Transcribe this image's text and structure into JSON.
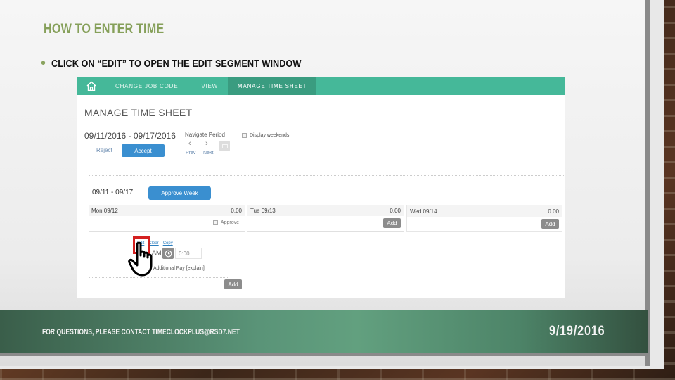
{
  "slide": {
    "title": "HOW TO ENTER TIME",
    "bullet": "CLICK ON “EDIT” TO OPEN THE EDIT SEGMENT WINDOW",
    "footer_text": "FOR QUESTIONS, PLEASE CONTACT TIMECLOCKPLUS@RSD7.NET",
    "footer_date": "9/19/2016",
    "colors": {
      "title": "#86a05a",
      "footer_green": "#5a9478",
      "nav_teal": "#45b899",
      "button_blue": "#3a8fd0",
      "highlight_red": "#d42020"
    }
  },
  "app": {
    "nav": {
      "home_icon": "home-icon",
      "items": [
        {
          "label": "CHANGE  JOB  CODE",
          "active": false
        },
        {
          "label": "VIEW",
          "active": false
        },
        {
          "label": "MANAGE  TIME  SHEET",
          "active": true
        }
      ]
    },
    "page_title": "MANAGE TIME SHEET",
    "period": "09/11/2016 - 09/17/2016",
    "reject_label": "Reject",
    "accept_label": "Accept",
    "navigate_period_label": "Navigate Period",
    "prev_label": "Prev",
    "next_label": "Next",
    "display_weekends_label": "Display weekends",
    "week_range": "09/11 - 09/17",
    "approve_week_label": "Approve Week",
    "days": [
      {
        "label": "Mon 09/12",
        "total": "0.00",
        "approve_label": "Approve"
      },
      {
        "label": "Tue 09/13",
        "total": "0.00",
        "add_label": "Add"
      },
      {
        "label": "Wed 09/14",
        "total": "0.00",
        "add_label": "Add"
      }
    ],
    "segment": {
      "edit_label": "Edit",
      "clear_label": "Clear",
      "copy_label": "Copy",
      "am_label": "AM",
      "time_value": "0:00",
      "pay_text": "Additional Pay [explain]",
      "add_label": "Add"
    }
  }
}
